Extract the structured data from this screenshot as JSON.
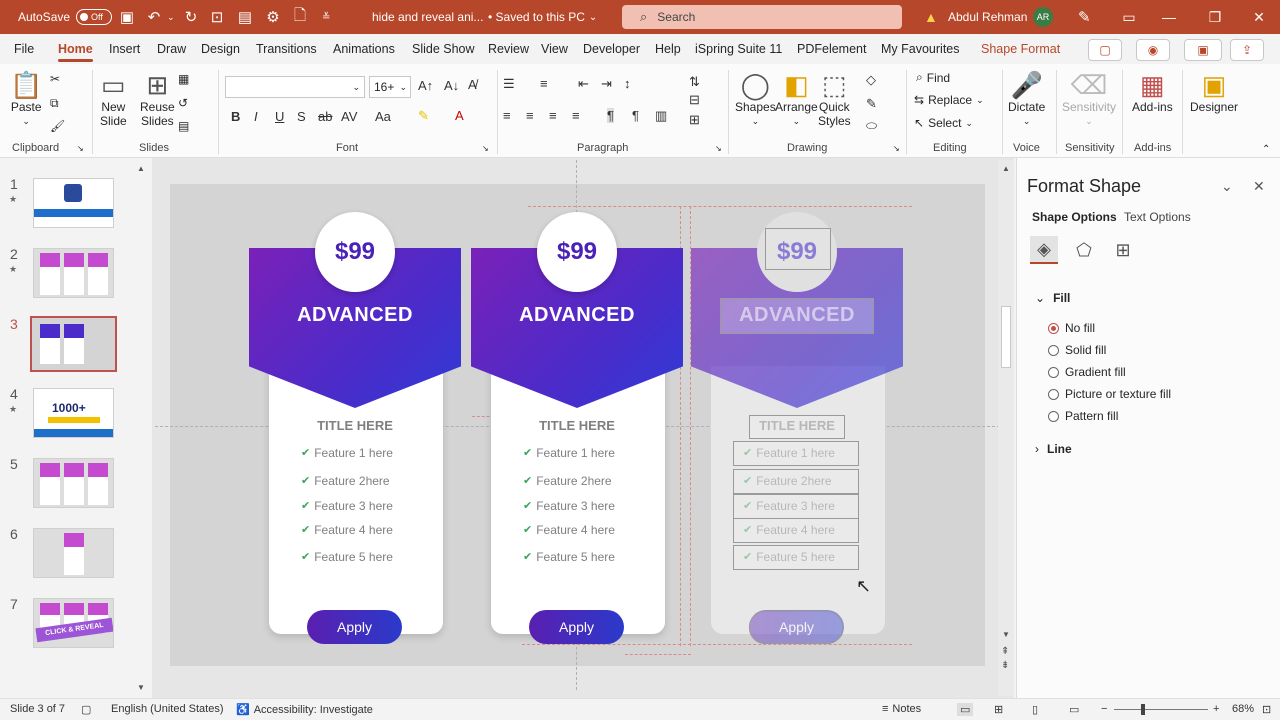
{
  "titlebar": {
    "autosave_label": "AutoSave",
    "autosave_state": "Off",
    "doc_title": "hide and reveal ani...",
    "save_status": "• Saved to this PC",
    "search_placeholder": "Search",
    "user_name": "Abdul Rehman",
    "user_initials": "AR"
  },
  "menu": {
    "tabs": [
      "File",
      "Home",
      "Insert",
      "Draw",
      "Design",
      "Transitions",
      "Animations",
      "Slide Show",
      "Review",
      "View",
      "Developer",
      "Help",
      "iSpring Suite 11",
      "PDFelement",
      "My Favourites",
      "Shape Format"
    ],
    "active": "Home"
  },
  "ribbon": {
    "clipboard": {
      "paste": "Paste",
      "label": "Clipboard"
    },
    "slides": {
      "new_slide": "New Slide",
      "reuse_slides": "Reuse Slides",
      "label": "Slides",
      "new_slide_l1": "New",
      "new_slide_l2": "Slide",
      "reuse_l1": "Reuse",
      "reuse_l2": "Slides"
    },
    "font": {
      "label": "Font",
      "size": "16+"
    },
    "paragraph": {
      "label": "Paragraph"
    },
    "drawing": {
      "shapes": "Shapes",
      "arrange": "Arrange",
      "quick_l1": "Quick",
      "quick_l2": "Styles",
      "label": "Drawing"
    },
    "editing": {
      "find": "Find",
      "replace": "Replace",
      "select": "Select",
      "label": "Editing"
    },
    "voice": {
      "dictate": "Dictate",
      "label": "Voice"
    },
    "sensitivity": {
      "button": "Sensitivity",
      "label": "Sensitivity"
    },
    "addins": {
      "button": "Add-ins",
      "label": "Add-ins"
    },
    "designer": {
      "button": "Designer"
    }
  },
  "slides_panel": {
    "numbers": [
      "1",
      "2",
      "3",
      "4",
      "5",
      "6",
      "7"
    ],
    "active": "3",
    "thumb4_text": "1000+",
    "thumb7_text": "CLICK & REVEAL"
  },
  "cards": [
    {
      "price": "$99",
      "title": "ADVANCED",
      "subtitle": "TITLE HERE",
      "features": [
        "Feature 1 here",
        "Feature 2here",
        "Feature 3 here",
        "Feature 4 here",
        "Feature 5 here"
      ],
      "button": "Apply"
    },
    {
      "price": "$99",
      "title": "ADVANCED",
      "subtitle": "TITLE HERE",
      "features": [
        "Feature 1 here",
        "Feature 2here",
        "Feature 3 here",
        "Feature 4 here",
        "Feature 5 here"
      ],
      "button": "Apply"
    },
    {
      "price": "$99",
      "title": "ADVANCED",
      "subtitle": "TITLE HERE",
      "features": [
        "Feature 1 here",
        "Feature 2here",
        "Feature 3 here",
        "Feature 4 here",
        "Feature 5 here"
      ],
      "button": "Apply"
    }
  ],
  "format_pane": {
    "title": "Format Shape",
    "tab_shape": "Shape Options",
    "tab_text": "Text Options",
    "fill_section": "Fill",
    "fill_options": [
      "No fill",
      "Solid fill",
      "Gradient fill",
      "Picture or texture fill",
      "Pattern fill"
    ],
    "fill_selected": "No fill",
    "line_section": "Line"
  },
  "statusbar": {
    "slide_info": "Slide 3 of 7",
    "language": "English (United States)",
    "accessibility": "Accessibility: Investigate",
    "notes": "Notes",
    "zoom": "68%"
  },
  "colors": {
    "accent": "#b7472a",
    "card_gradient_start": "#7a21b8",
    "card_gradient_end": "#2f3bd8",
    "check_green": "#3aa55c"
  }
}
